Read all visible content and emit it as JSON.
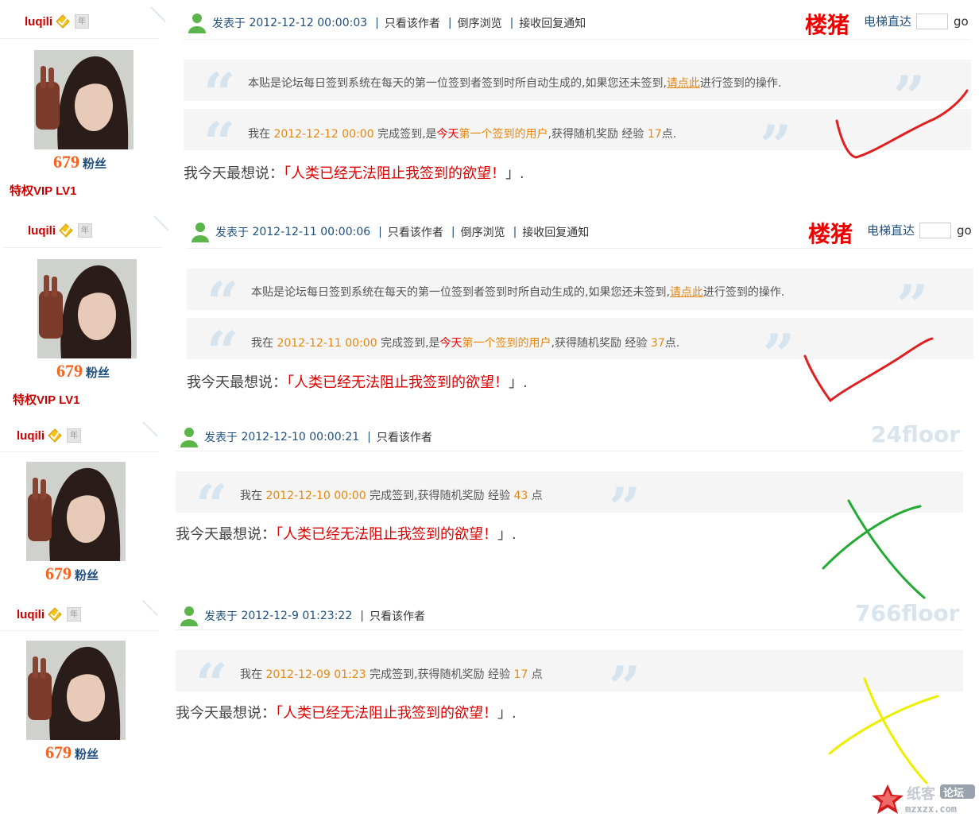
{
  "colors": {
    "author": "#cc0000",
    "fans_num": "#f26522",
    "link_blue": "#1e4f7e",
    "orange": "#e8870f",
    "red": "#ee0000",
    "check_red": "#e02020",
    "cross_green": "#22aa33",
    "cross_yellow": "#eeee00"
  },
  "icons": [
    "user-icon",
    "medal-icon",
    "nian-badge",
    "quote-open-icon",
    "quote-close-icon",
    "check-mark",
    "cross-mark"
  ],
  "labels": {
    "posted_at": "发表于",
    "only_author": "只看该作者",
    "reverse_browse": "倒序浏览",
    "reply_notify": "接收回复通知",
    "louzhu": "楼猪",
    "jump": "电梯直达",
    "go": "go",
    "sep": "|",
    "fans": "粉丝",
    "nian": "年",
    "say_prefix": "我今天最想说：",
    "say_open": "「",
    "say_close": "」.",
    "quote_open": "“",
    "quote_close": "”"
  },
  "posts": [
    {
      "author": "luqili",
      "fans_count": "679",
      "vip": "特权VIP LV1",
      "time": "2012-12-12 00:00:03",
      "floor": "",
      "notice": {
        "pre": "本贴是论坛每日签到系统在每天的第一位签到者签到时所自动生成的,如果您还未签到,",
        "link": "请点此",
        "post": "进行签到的操作."
      },
      "checkin": {
        "p1": "我在 ",
        "time": "2012-12-12 00:00",
        "p2": " 完成签到,是",
        "today": "今天",
        "first": "第一个签到的用户",
        "p3": ",获得随机奖励 经验 ",
        "exp": "17",
        "p4": "点."
      },
      "say": "人类已经无法阻止我签到的欲望！"
    },
    {
      "author": "luqili",
      "fans_count": "679",
      "vip": "特权VIP LV1",
      "time": "2012-12-11 00:00:06",
      "floor": "",
      "notice": {
        "pre": "本贴是论坛每日签到系统在每天的第一位签到者签到时所自动生成的,如果您还未签到,",
        "link": "请点此",
        "post": "进行签到的操作."
      },
      "checkin": {
        "p1": "我在 ",
        "time": "2012-12-11 00:00",
        "p2": " 完成签到,是",
        "today": "今天",
        "first": "第一个签到的用户",
        "p3": ",获得随机奖励 经验 ",
        "exp": "37",
        "p4": "点."
      },
      "say": "人类已经无法阻止我签到的欲望！"
    },
    {
      "author": "luqili",
      "fans_count": "679",
      "time": "2012-12-10 00:00:21",
      "floor": "24floor",
      "checkin": {
        "p1": "我在 ",
        "time": "2012-12-10 00:00",
        "p2": " 完成签到,获得随机奖励 经验 ",
        "exp": "43",
        "p4": " 点"
      },
      "say": "人类已经无法阻止我签到的欲望！"
    },
    {
      "author": "luqili",
      "fans_count": "679",
      "time": "2012-12-9 01:23:22",
      "floor": "766floor",
      "checkin": {
        "p1": "我在 ",
        "time": "2012-12-09 01:23",
        "p2": " 完成签到,获得随机奖励 经验 ",
        "exp": "17",
        "p4": " 点"
      },
      "say": "人类已经无法阻止我签到的欲望！"
    }
  ],
  "watermark": {
    "cn": "纸客",
    "tag": "论坛",
    "url": "mzxzx.com"
  }
}
